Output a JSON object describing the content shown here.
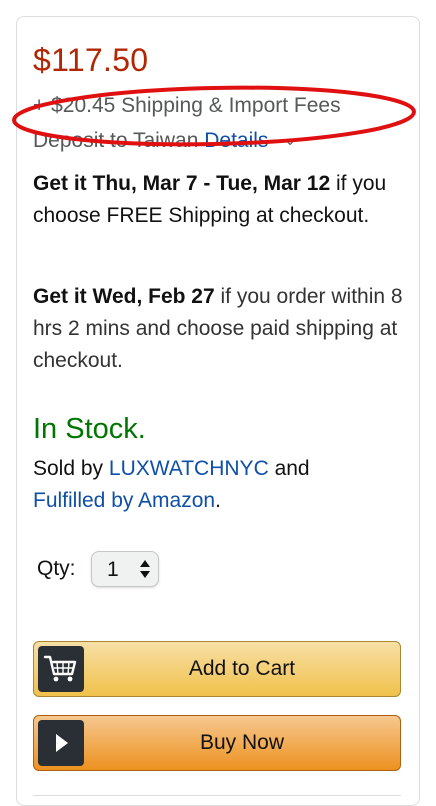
{
  "price": "$117.50",
  "shipping": {
    "fees_text": "+ $20.45 Shipping & Import Fees",
    "deposit_text": "Deposit to Taiwan",
    "details_link": "Details"
  },
  "delivery": {
    "free_bold": "Get it Thu, Mar 7 - Tue, Mar 12",
    "free_rest": " if you choose FREE Shipping at checkout.",
    "paid_bold": "Get it Wed, Feb 27",
    "paid_rest": " if you order within 8 hrs 2 mins and choose paid shipping at checkout."
  },
  "stock": "In Stock.",
  "seller": {
    "sold_by": "Sold by ",
    "seller_name": "LUXWATCHNYC",
    "and": " and",
    "fulfilled": "Fulfilled by Amazon",
    "period": "."
  },
  "quantity": {
    "label": "Qty:",
    "value": "1"
  },
  "buttons": {
    "add_to_cart": "Add to Cart",
    "buy_now": "Buy Now"
  },
  "colors": {
    "price": "#b12704",
    "link": "#0f4fa8",
    "in_stock": "#007600",
    "annotation_ring": "#e01010"
  },
  "icons": {
    "cart": "cart-icon",
    "buy": "play-icon",
    "qty": "updown-arrows-icon",
    "details": "chevron-down-icon"
  }
}
